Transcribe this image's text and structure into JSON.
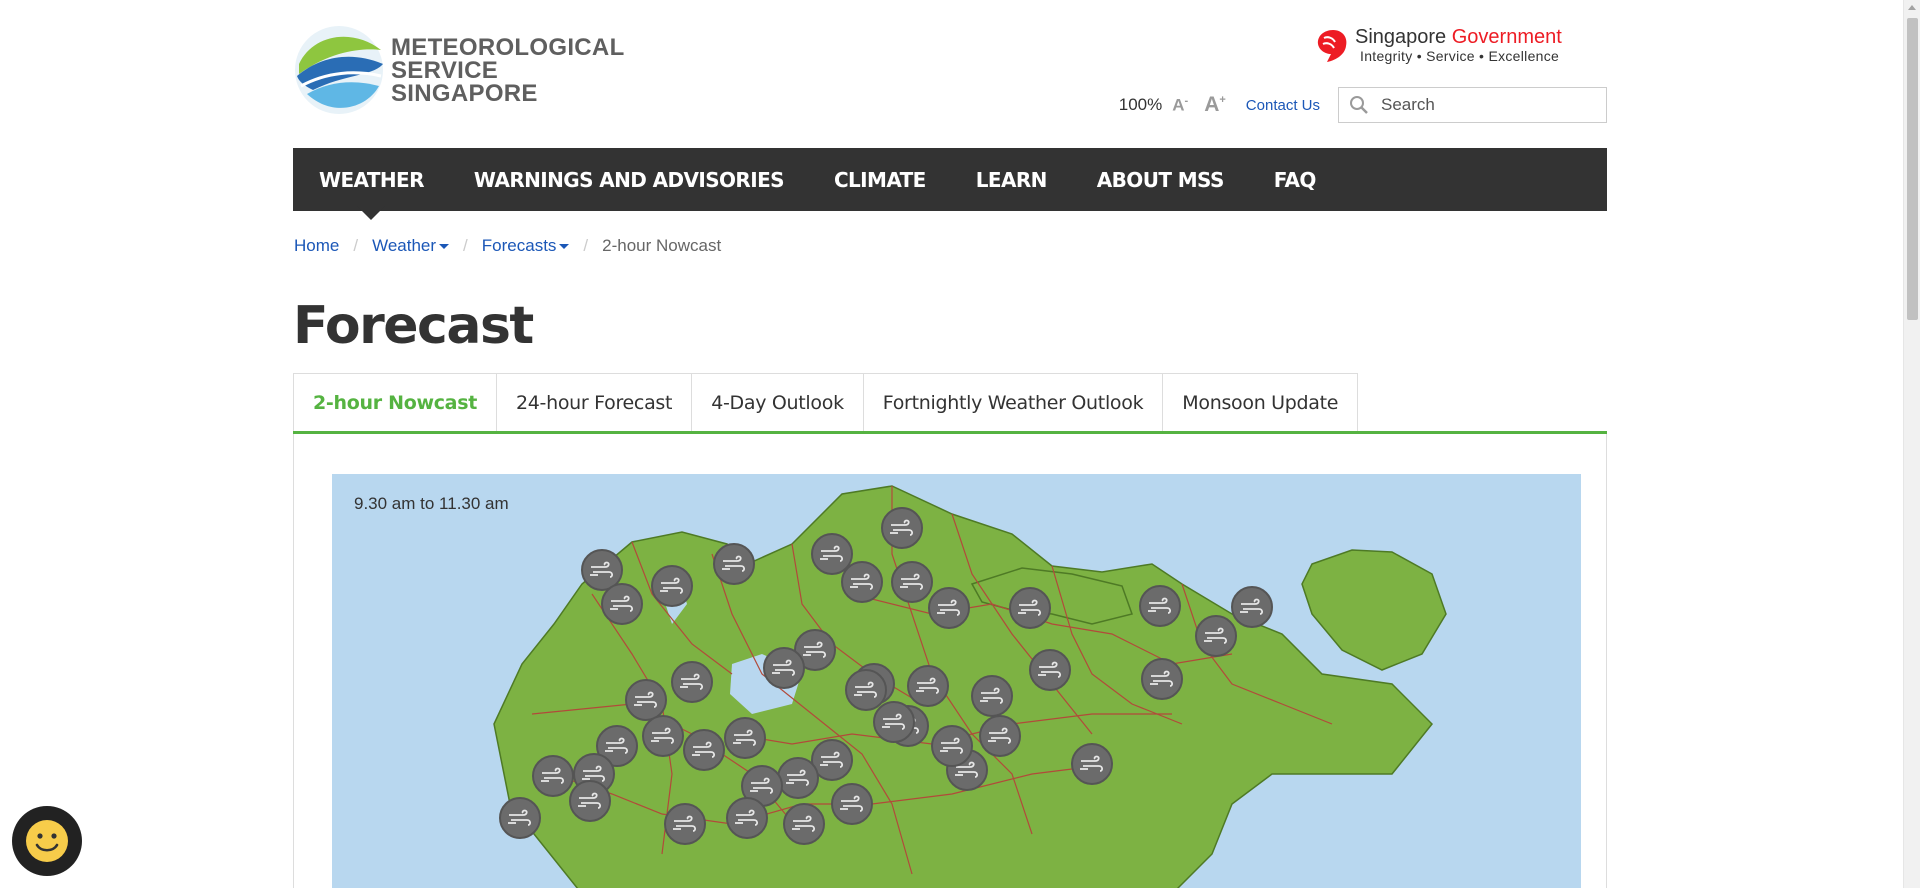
{
  "header": {
    "logo": {
      "line1": "Meteorological",
      "line2": "Service",
      "line3": "Singapore"
    },
    "gov": {
      "name_a": "Singapore",
      "name_b": "Government",
      "tagline": "Integrity • Service • Excellence"
    },
    "tools": {
      "zoom": "100%",
      "font_decrease": "A",
      "font_decrease_sup": "-",
      "font_increase": "A",
      "font_increase_sup": "+",
      "contact": "Contact Us",
      "search_placeholder": "Search"
    }
  },
  "nav": {
    "items": [
      "WEATHER",
      "WARNINGS AND ADVISORIES",
      "CLIMATE",
      "LEARN",
      "ABOUT MSS",
      "FAQ"
    ],
    "active": "WEATHER"
  },
  "breadcrumb": {
    "home": "Home",
    "weather": "Weather",
    "forecasts": "Forecasts",
    "current": "2-hour Nowcast",
    "separator": "/"
  },
  "page_title": "Forecast",
  "tabs": {
    "items": [
      "2-hour Nowcast",
      "24-hour Forecast",
      "4-Day Outlook",
      "Fortnightly Weather Outlook",
      "Monsoon Update"
    ],
    "active": "2-hour Nowcast"
  },
  "nowcast": {
    "time_range": "9.30 am to 11.30 am",
    "icon_name": "windy-icon",
    "icon_count": 44
  },
  "colors": {
    "nav_bg": "#333333",
    "accent_green": "#55b341",
    "link_blue": "#1b57b7",
    "sea": "#b8d7ef",
    "land": "#7db243",
    "gov_red": "#ed1c24"
  }
}
